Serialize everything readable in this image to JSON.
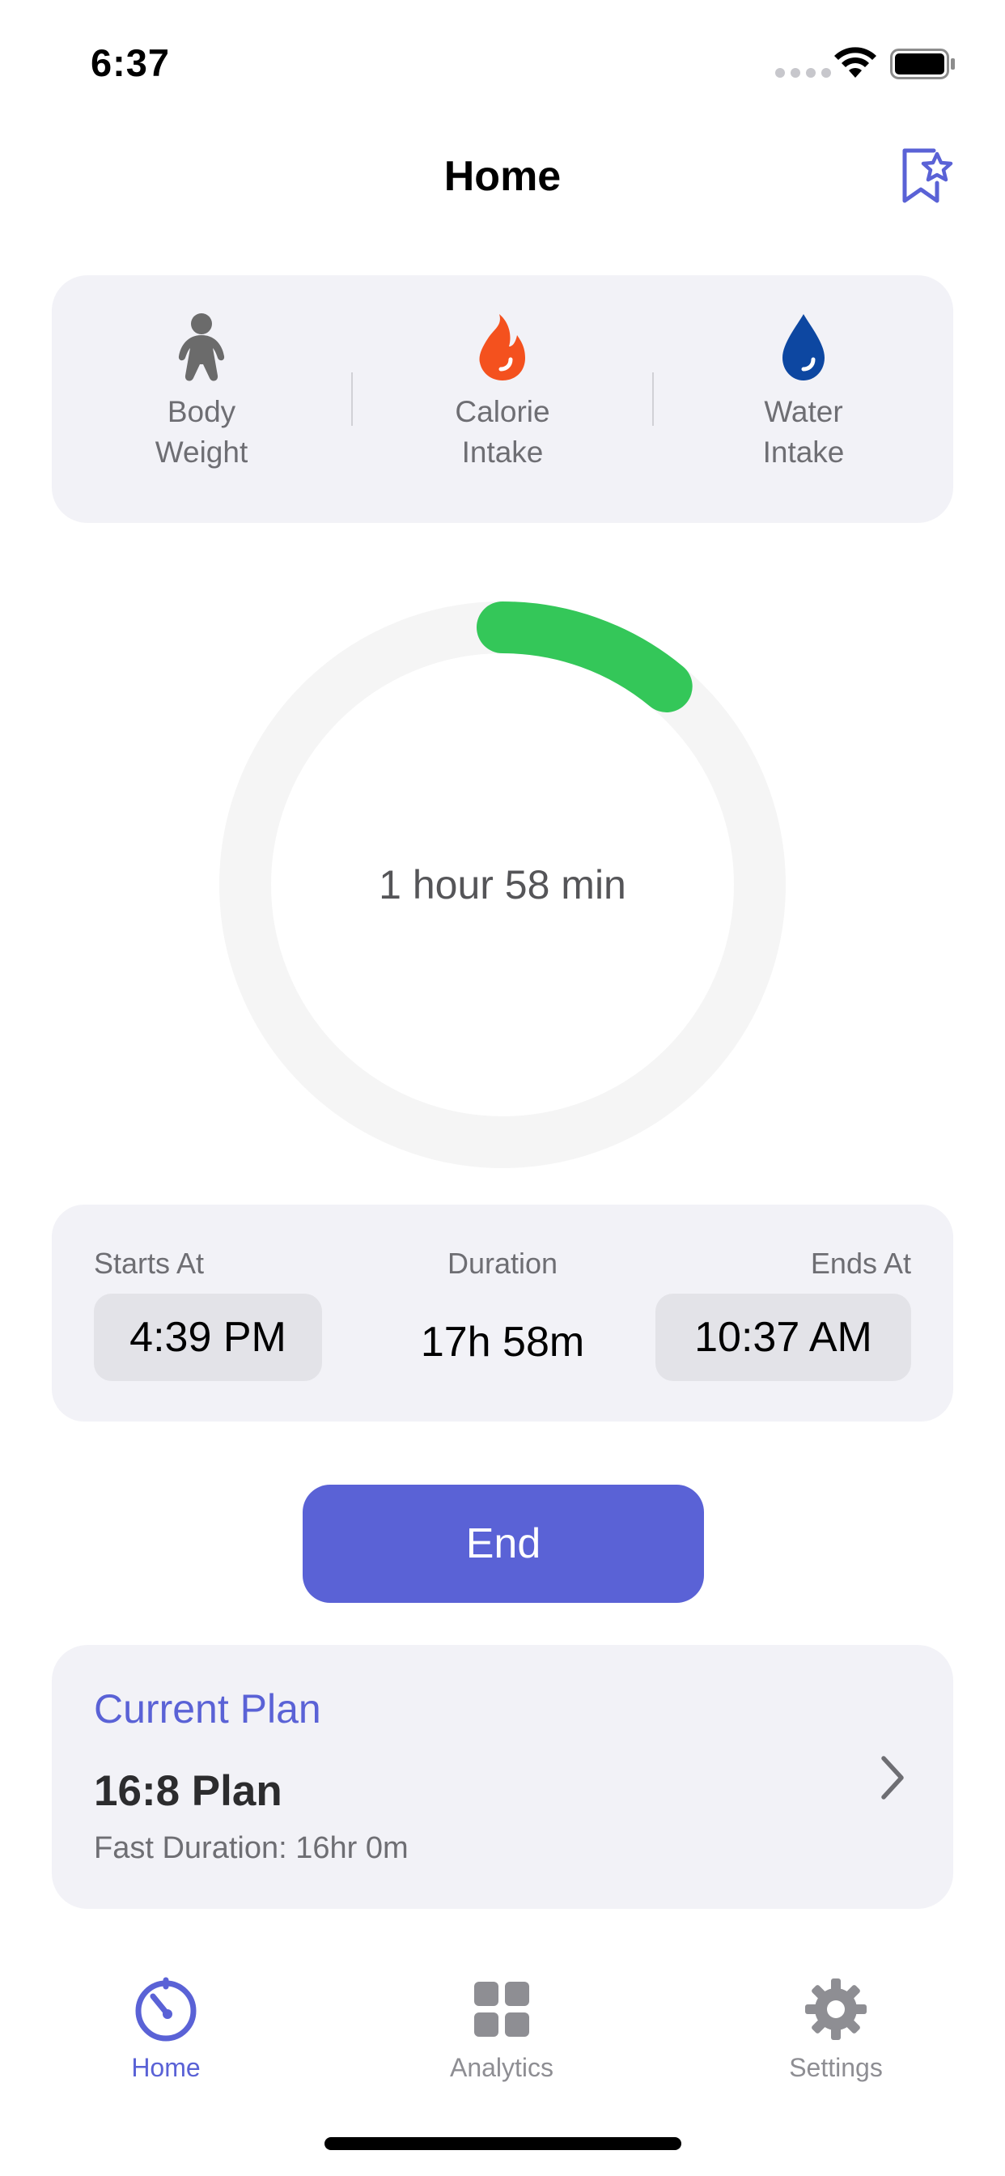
{
  "status_bar": {
    "time": "6:37"
  },
  "nav": {
    "title": "Home"
  },
  "trackers": [
    {
      "label": "Body\nWeight",
      "icon": "body-weight-icon",
      "color": "#6b6b6b"
    },
    {
      "label": "Calorie\nIntake",
      "icon": "flame-icon",
      "color": "#f4511e"
    },
    {
      "label": "Water\nIntake",
      "icon": "water-drop-icon",
      "color": "#0d47a1"
    }
  ],
  "ring": {
    "elapsed_text": "1 hour 58 min",
    "progress_fraction": 0.11,
    "progress_color": "#34c759",
    "track_color": "#f5f5f5"
  },
  "schedule": {
    "starts_label": "Starts At",
    "starts_value": "4:39 PM",
    "duration_label": "Duration",
    "duration_value": "17h 58m",
    "ends_label": "Ends At",
    "ends_value": "10:37 AM"
  },
  "end_button": {
    "label": "End",
    "color": "#5a62d6"
  },
  "plan": {
    "header": "Current Plan",
    "name": "16:8 Plan",
    "detail": "Fast Duration: 16hr 0m"
  },
  "tabs": [
    {
      "label": "Home",
      "icon": "timer-icon",
      "active": true
    },
    {
      "label": "Analytics",
      "icon": "grid-icon",
      "active": false
    },
    {
      "label": "Settings",
      "icon": "gear-icon",
      "active": false
    }
  ],
  "colors": {
    "accent": "#5a62d6",
    "inactive": "#8e8e93"
  }
}
